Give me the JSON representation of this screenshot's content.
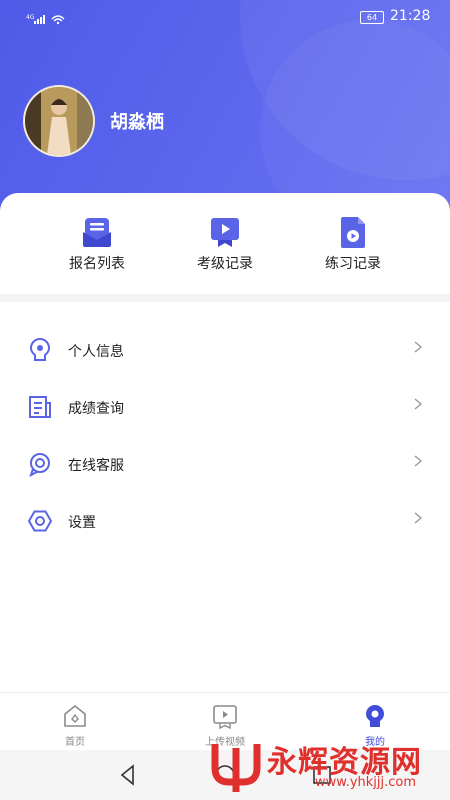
{
  "status_bar": {
    "network": "4G",
    "battery": "64",
    "time": "21:28"
  },
  "profile": {
    "name": "胡淼栖"
  },
  "quick_actions": [
    {
      "label": "报名列表",
      "icon": "signup-list-icon"
    },
    {
      "label": "考级记录",
      "icon": "exam-record-icon"
    },
    {
      "label": "练习记录",
      "icon": "practice-record-icon"
    }
  ],
  "menu": [
    {
      "label": "个人信息",
      "icon": "user-info-icon"
    },
    {
      "label": "成绩查询",
      "icon": "score-query-icon"
    },
    {
      "label": "在线客服",
      "icon": "customer-service-icon"
    },
    {
      "label": "设置",
      "icon": "settings-icon"
    }
  ],
  "tabbar": [
    {
      "label": "首页",
      "icon": "home-icon",
      "active": false
    },
    {
      "label": "上传视频",
      "icon": "upload-video-icon",
      "active": false
    },
    {
      "label": "我的",
      "icon": "mine-icon",
      "active": true
    }
  ],
  "watermark": {
    "text": "永辉资源网",
    "url": "www.yhkjjj.com"
  },
  "colors": {
    "primary": "#4f5be8",
    "icon_accent": "#5a64e6",
    "active_tab": "#3f4dd8",
    "watermark": "#e0302e"
  }
}
